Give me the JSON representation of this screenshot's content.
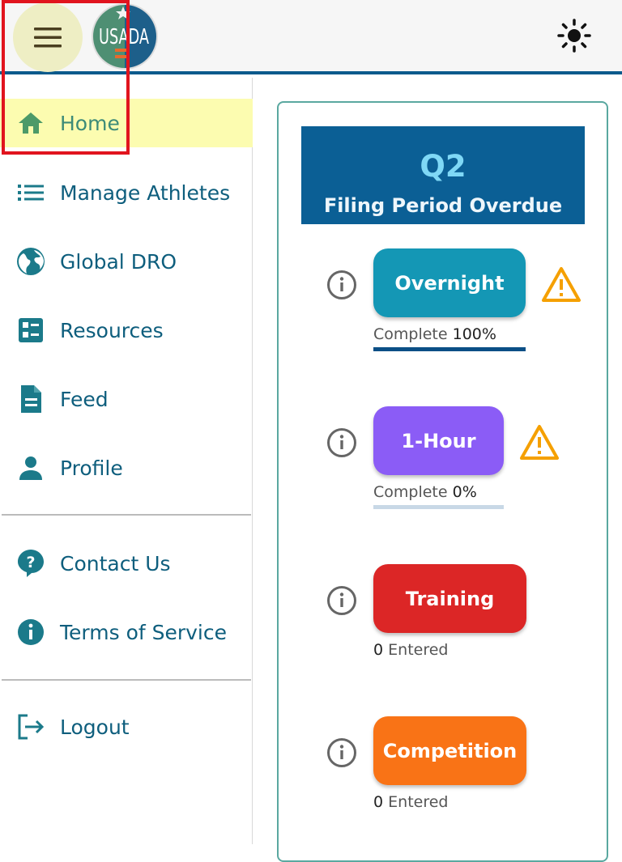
{
  "header": {
    "menu_icon": "hamburger-icon",
    "logo_text": "USADA",
    "theme_icon": "sun-icon"
  },
  "sidebar": {
    "items": [
      {
        "label": "Home",
        "icon": "home-icon",
        "active": true
      },
      {
        "label": "Manage Athletes",
        "icon": "list-icon"
      },
      {
        "label": "Global DRO",
        "icon": "globe-icon"
      },
      {
        "label": "Resources",
        "icon": "resources-icon"
      },
      {
        "label": "Feed",
        "icon": "document-icon"
      },
      {
        "label": "Profile",
        "icon": "person-icon"
      },
      {
        "label": "Contact Us",
        "icon": "help-icon"
      },
      {
        "label": "Terms of Service",
        "icon": "info-icon"
      },
      {
        "label": "Logout",
        "icon": "logout-icon"
      }
    ]
  },
  "filing": {
    "quarter": "Q2",
    "status": "Filing Period Overdue"
  },
  "tiles": [
    {
      "label": "Overnight",
      "color": "#1497b5",
      "stat_label": "Complete",
      "stat_value": "100%",
      "progress": 1.0,
      "warning": true
    },
    {
      "label": "1-Hour",
      "color": "#8b5cf6",
      "stat_label": "Complete",
      "stat_value": "0%",
      "progress": 0.0,
      "warning": true
    },
    {
      "label": "Training",
      "color": "#dc2626",
      "stat_value": "0",
      "stat_label": "Entered",
      "warning": false
    },
    {
      "label": "Competition",
      "color": "#f97316",
      "stat_value": "0",
      "stat_label": "Entered",
      "warning": false
    }
  ],
  "colors": {
    "brand_blue": "#0b5f95",
    "nav_text": "#0e5e7d",
    "active_bg": "#fcfcb0",
    "warning": "#f5a000"
  }
}
